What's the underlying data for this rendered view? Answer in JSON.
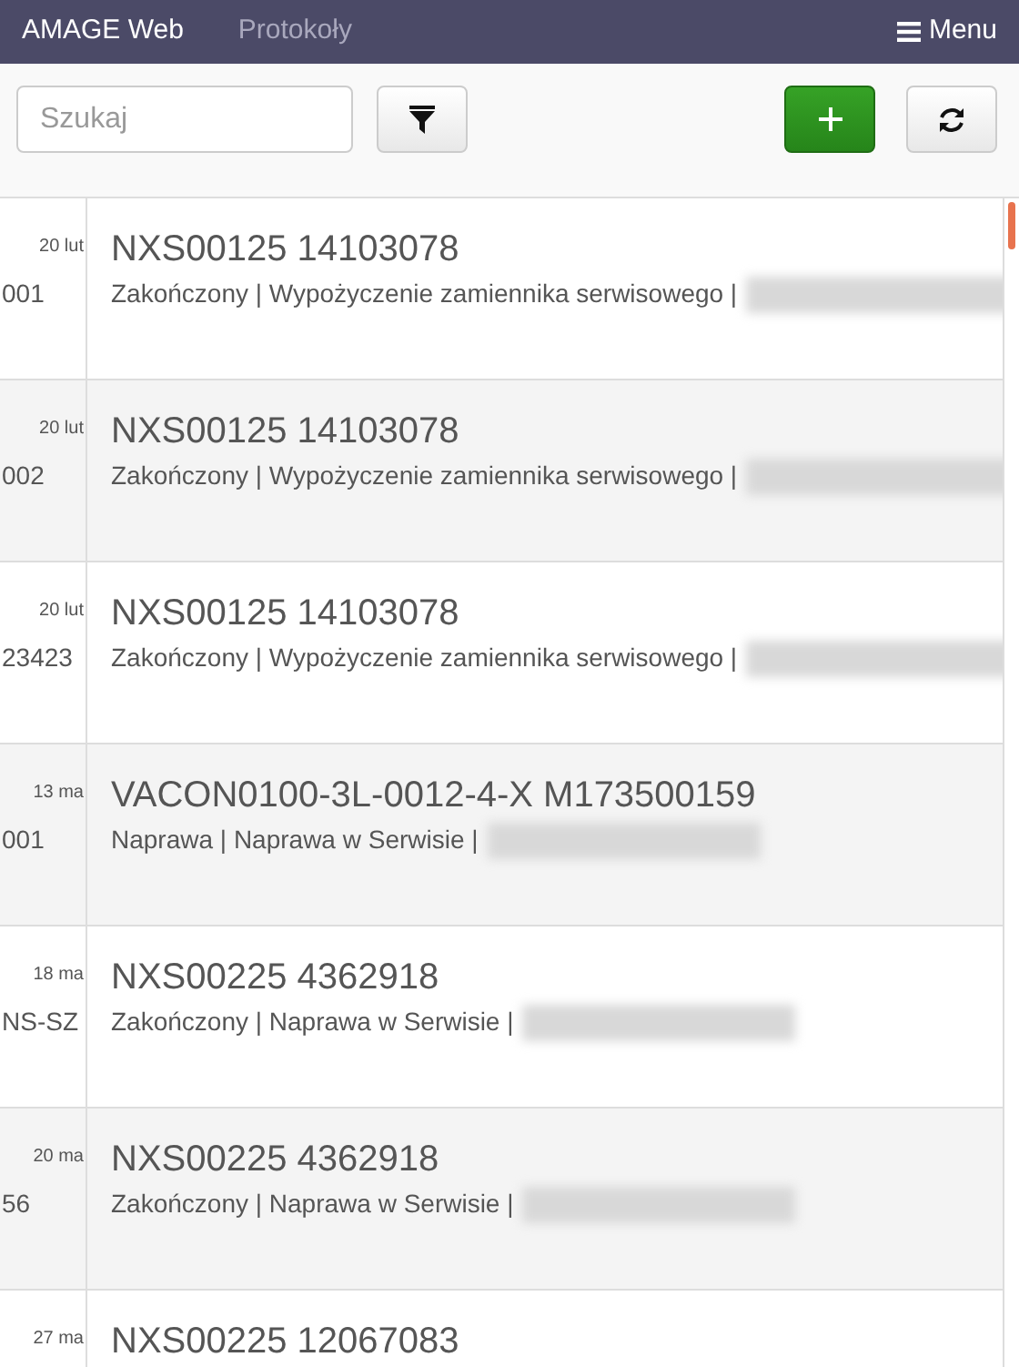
{
  "navbar": {
    "brand": "AMAGE Web",
    "link": "Protokoły",
    "menu": "Menu"
  },
  "toolbar": {
    "search": {
      "placeholder": "Szukaj"
    }
  },
  "rows": [
    {
      "date": "20 lut",
      "number": "001",
      "title": "NXS00125 14103078",
      "subtitle": "Zakończony | Wypożyczenie zamiennika serwisowego |"
    },
    {
      "date": "20 lut",
      "number": "002",
      "title": "NXS00125 14103078",
      "subtitle": "Zakończony | Wypożyczenie zamiennika serwisowego |"
    },
    {
      "date": "20 lut",
      "number": "23423",
      "title": "NXS00125 14103078",
      "subtitle": "Zakończony | Wypożyczenie zamiennika serwisowego |"
    },
    {
      "date": "13 ma",
      "number": "001",
      "title": "VACON0100-3L-0012-4-X M173500159",
      "subtitle": "Naprawa | Naprawa w Serwisie |"
    },
    {
      "date": "18 ma",
      "number": "NS-SZ",
      "title": "NXS00225 4362918",
      "subtitle": "Zakończony | Naprawa w Serwisie |"
    },
    {
      "date": "20 ma",
      "number": "56",
      "title": "NXS00225 4362918",
      "subtitle": "Zakończony | Naprawa w Serwisie |"
    },
    {
      "date": "27 ma",
      "title": "NXS00225 12067083"
    }
  ]
}
